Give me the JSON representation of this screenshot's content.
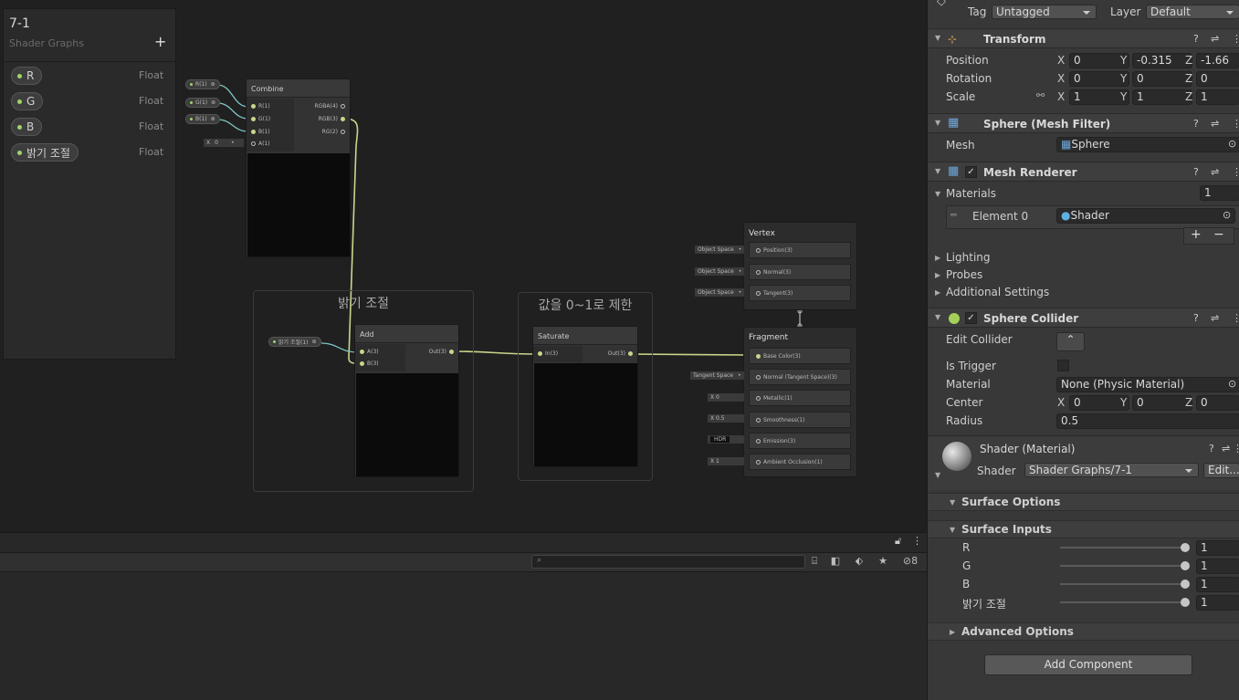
{
  "blackboard": {
    "title": "7-1",
    "subtitle": "Shader Graphs",
    "add": "+",
    "properties": [
      {
        "name": "R",
        "type": "Float"
      },
      {
        "name": "G",
        "type": "Float"
      },
      {
        "name": "B",
        "type": "Float"
      },
      {
        "name": "밝기 조절",
        "type": "Float"
      }
    ]
  },
  "graph": {
    "inputs": {
      "r": "R(1)",
      "g": "G(1)",
      "b": "B(1)",
      "brightness": "밝기 조절(1)"
    },
    "combine": {
      "title": "Combine",
      "in": [
        "R(1)",
        "G(1)",
        "B(1)",
        "A(1)"
      ],
      "out": [
        "RGBA(4)",
        "RGB(3)",
        "RG(2)"
      ],
      "a_axis": "X",
      "a_value": "0"
    },
    "group1": {
      "title": "밝기 조절"
    },
    "group2": {
      "title": "값을 0~1로 제한"
    },
    "add": {
      "title": "Add",
      "in": [
        "A(3)",
        "B(3)"
      ],
      "out": "Out(3)"
    },
    "saturate": {
      "title": "Saturate",
      "in": "In(3)",
      "out": "Out(3)"
    },
    "vertex": {
      "title": "Vertex",
      "rows": [
        {
          "src": "Object Space",
          "label": "Position(3)"
        },
        {
          "src": "Object Space",
          "label": "Normal(3)"
        },
        {
          "src": "Object Space",
          "label": "Tangent(3)"
        }
      ]
    },
    "fragment": {
      "title": "Fragment",
      "rows": [
        {
          "src": "",
          "label": "Base Color(3)"
        },
        {
          "src": "Tangent Space",
          "label": "Normal (Tangent Space)(3)"
        },
        {
          "src": "X 0",
          "label": "Metallic(1)"
        },
        {
          "src": "X 0.5",
          "label": "Smoothness(1)"
        },
        {
          "src": "HDR",
          "label": "Emission(3)"
        },
        {
          "src": "X 1",
          "label": "Ambient Occlusion(1)"
        }
      ]
    }
  },
  "console": {
    "search_placeholder": "",
    "hidden_count": "8"
  },
  "inspector": {
    "tag_label": "Tag",
    "tag_value": "Untagged",
    "layer_label": "Layer",
    "layer_value": "Default",
    "transform": {
      "title": "Transform",
      "position_label": "Position",
      "rotation_label": "Rotation",
      "scale_label": "Scale",
      "position": {
        "x": "0",
        "y": "-0.315",
        "z": "-1.66"
      },
      "rotation": {
        "x": "0",
        "y": "0",
        "z": "0"
      },
      "scale": {
        "x": "1",
        "y": "1",
        "z": "1"
      }
    },
    "mesh_filter": {
      "title": "Sphere (Mesh Filter)",
      "mesh_label": "Mesh",
      "mesh_value": "Sphere"
    },
    "mesh_renderer": {
      "title": "Mesh Renderer",
      "materials_label": "Materials",
      "materials_count": "1",
      "element_label": "Element 0",
      "element_value": "Shader",
      "plus": "+",
      "minus": "−",
      "lighting": "Lighting",
      "probes": "Probes",
      "additional": "Additional Settings"
    },
    "sphere_collider": {
      "title": "Sphere Collider",
      "edit_label": "Edit Collider",
      "trigger_label": "Is Trigger",
      "material_label": "Material",
      "material_value": "None (Physic Material)",
      "center_label": "Center",
      "center": {
        "x": "0",
        "y": "0",
        "z": "0"
      },
      "radius_label": "Radius",
      "radius_value": "0.5"
    },
    "material": {
      "title": "Shader (Material)",
      "shader_label": "Shader",
      "shader_value": "Shader Graphs/7-1",
      "edit": "Edit...",
      "surface_options": "Surface Options",
      "surface_inputs": "Surface Inputs",
      "inputs": [
        {
          "label": "R",
          "value": "1"
        },
        {
          "label": "G",
          "value": "1"
        },
        {
          "label": "B",
          "value": "1"
        },
        {
          "label": "밝기 조절",
          "value": "1"
        }
      ],
      "advanced": "Advanced Options"
    },
    "add_component": "Add Component"
  }
}
